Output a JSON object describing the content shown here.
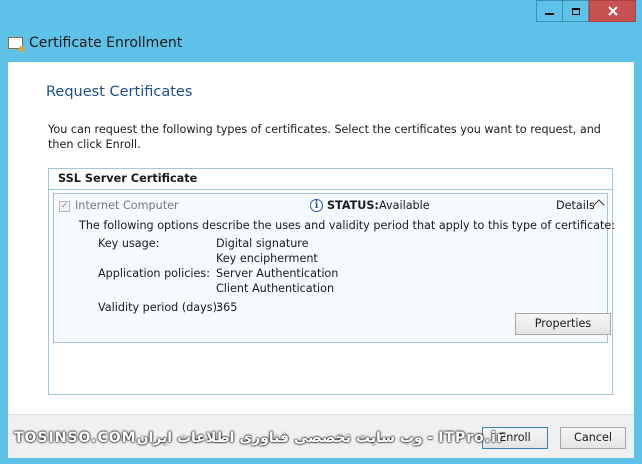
{
  "window": {
    "title": "Certificate Enrollment"
  },
  "page": {
    "heading": "Request Certificates",
    "intro": "You can request the following types of certificates. Select the certificates you want to request, and then click Enroll."
  },
  "certificate": {
    "group_title": "SSL Server Certificate",
    "name": "Internet Computer",
    "checked": true,
    "status_label": "STATUS:",
    "status_value": "Available",
    "details_label": "Details",
    "description": "The following options describe the uses and validity period that apply to this type of certificate:",
    "key_usage_label": "Key usage:",
    "key_usage_values": [
      "Digital signature",
      "Key encipherment"
    ],
    "application_policies_label": "Application policies:",
    "application_policies_values": [
      "Server Authentication",
      "Client Authentication"
    ],
    "validity_label": "Validity period (days):",
    "validity_value": "365",
    "properties_button": "Properties"
  },
  "footer": {
    "enroll_button": "Enroll",
    "cancel_button": "Cancel"
  },
  "watermark": "TOSINSO.COMوب سایت تخصصی فناوری اطلاعات ایران - ITPro.ir"
}
